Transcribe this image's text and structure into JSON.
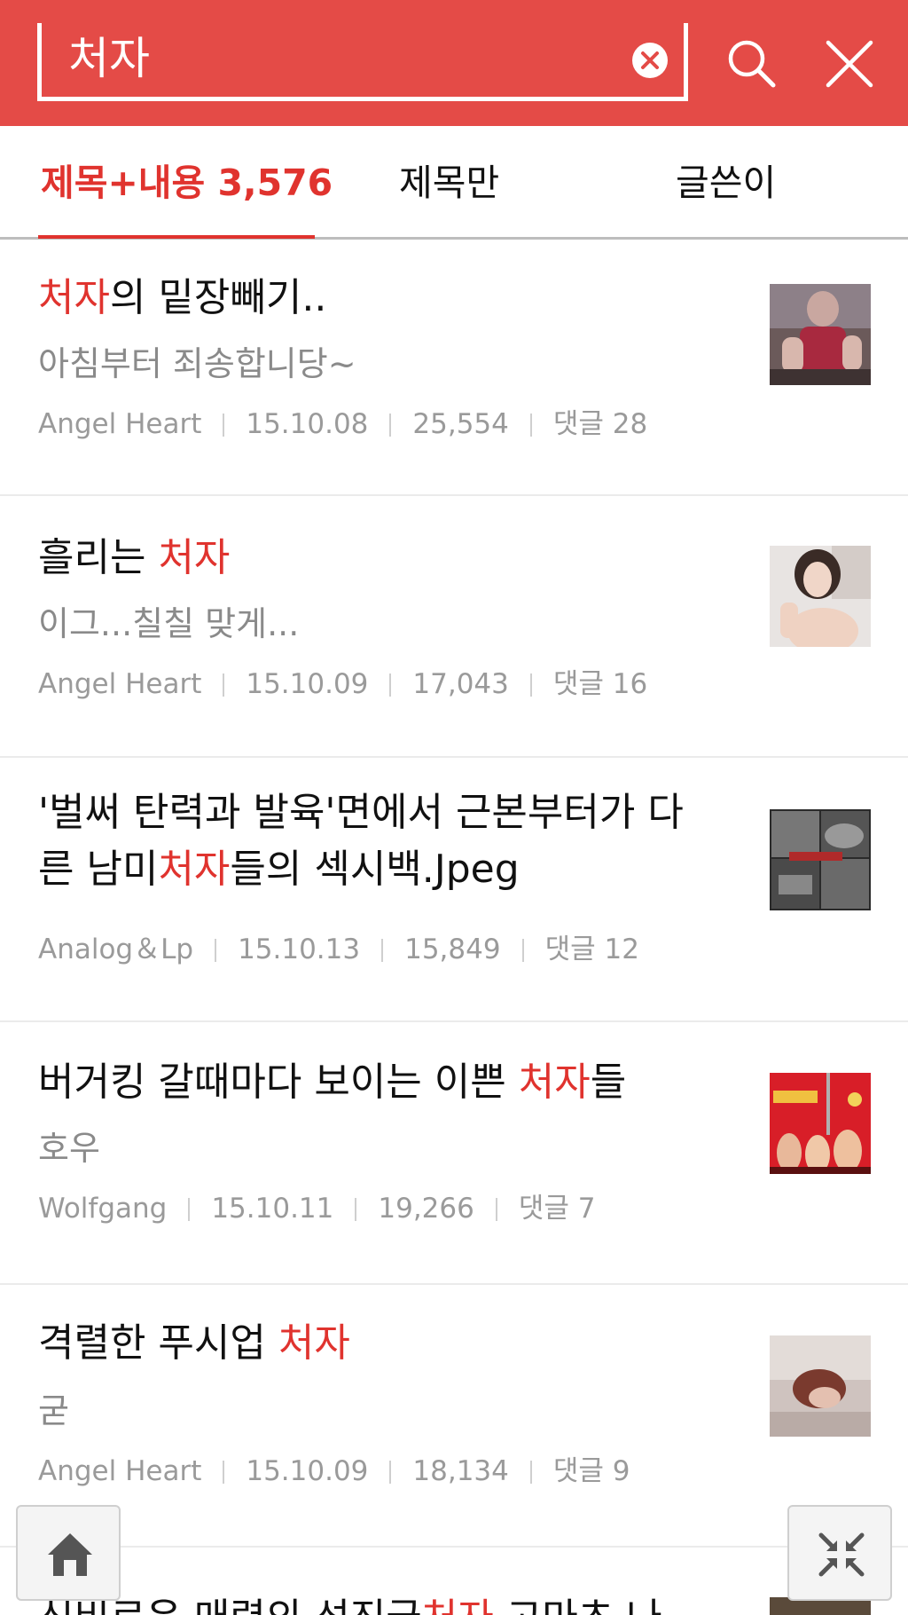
{
  "search": {
    "query": "처자"
  },
  "tabs": [
    {
      "label": "제목+내용 3,576",
      "active": true
    },
    {
      "label": "제목만",
      "active": false
    },
    {
      "label": "글쓴이",
      "active": false
    }
  ],
  "colors": {
    "header": "#e44b47",
    "accent": "#e0332e",
    "meta": "#9a9a9a"
  },
  "results": [
    {
      "title_parts": [
        "",
        "처자",
        "의 밑장빼기.."
      ],
      "subtitle": "아침부터 죄송합니당~",
      "author": "Angel Heart",
      "date": "15.10.08",
      "views": "25,554",
      "comments": "댓글 28",
      "thumb": "woman-in-red-dress"
    },
    {
      "title_parts": [
        "흘리는 ",
        "처자",
        ""
      ],
      "subtitle": "이그...칠칠 맞게...",
      "author": "Angel Heart",
      "date": "15.10.09",
      "views": "17,043",
      "comments": "댓글 16",
      "thumb": "woman-portrait"
    },
    {
      "title_line1": "'벌써 탄력과 발육'면에서 근본부터가 다",
      "title_parts": [
        "른 남미",
        "처자",
        "들의 섹시백.Jpeg"
      ],
      "subtitle": "",
      "author": "Analog＆Lp",
      "date": "15.10.13",
      "views": "15,849",
      "comments": "댓글 12",
      "thumb": "black-white-collage"
    },
    {
      "title_parts": [
        "버거킹 갈때마다 보이는 이쁜 ",
        "처자",
        "들"
      ],
      "subtitle": "호우",
      "author": "Wolfgang",
      "date": "15.10.11",
      "views": "19,266",
      "comments": "댓글 7",
      "thumb": "red-poster"
    },
    {
      "title_parts": [
        "격렬한 푸시업 ",
        "처자",
        ""
      ],
      "subtitle": "굳",
      "author": "Angel Heart",
      "date": "15.10.09",
      "views": "18,134",
      "comments": "댓글 9",
      "thumb": "woman-on-floor"
    }
  ],
  "partial_item": {
    "title_parts": [
      "신비로운 매력의 석진국",
      "처자",
      " 고마츠 나"
    ]
  },
  "fab": {
    "home_icon": "home-icon",
    "collapse_icon": "collapse-icon"
  }
}
